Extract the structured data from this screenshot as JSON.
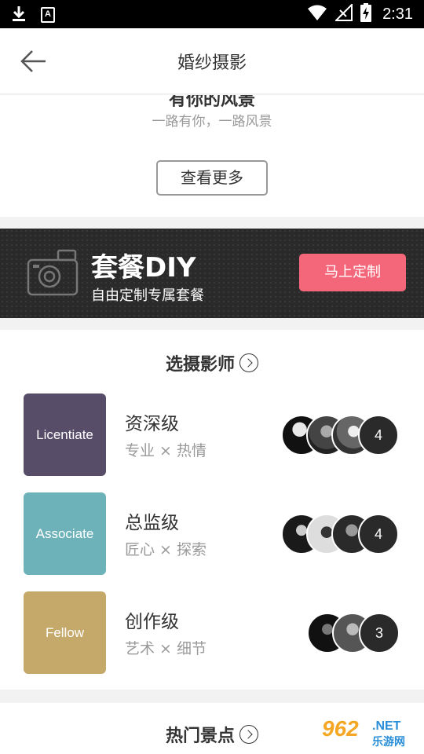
{
  "status_bar": {
    "time": "2:31",
    "badge_letter": "A"
  },
  "header": {
    "title": "婚纱摄影"
  },
  "intro": {
    "title_cut": "有你的风景",
    "subtitle": "一路有你，一路风景",
    "more_label": "查看更多"
  },
  "diy": {
    "title": "套餐DIY",
    "subtitle": "自由定制专属套餐",
    "button_label": "马上定制"
  },
  "photographers": {
    "heading": "选摄影师",
    "levels": [
      {
        "tile_label": "Licentiate",
        "tile_color": "#574d68",
        "name": "资深级",
        "desc": "专业 × 热情",
        "count": "4"
      },
      {
        "tile_label": "Associate",
        "tile_color": "#6db2b8",
        "name": "总监级",
        "desc": "匠心 × 探索",
        "count": "4"
      },
      {
        "tile_label": "Fellow",
        "tile_color": "#c5a96a",
        "name": "创作级",
        "desc": "艺术 × 细节",
        "count": "3"
      }
    ]
  },
  "hot_spots": {
    "heading": "热门景点"
  },
  "watermark": {
    "number": "962",
    "net": ".NET",
    "site": "乐游网"
  }
}
